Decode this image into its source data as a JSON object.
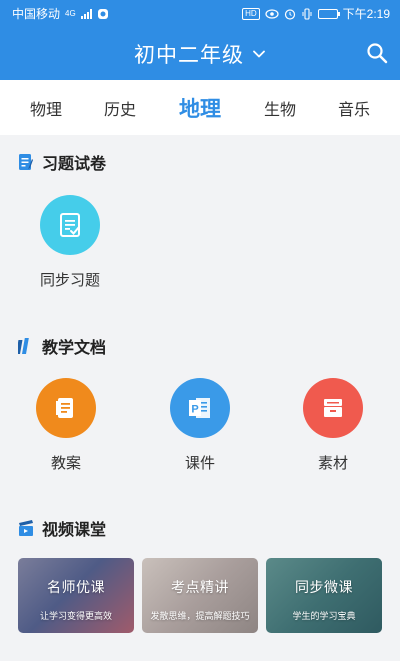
{
  "status_bar": {
    "carrier": "中国移动",
    "network": "4G",
    "hd": "HD",
    "time": "下午2:19"
  },
  "header": {
    "title": "初中二年级"
  },
  "tabs": [
    {
      "label": "物理"
    },
    {
      "label": "历史"
    },
    {
      "label": "地理"
    },
    {
      "label": "生物"
    },
    {
      "label": "音乐"
    }
  ],
  "active_tab": "地理",
  "sections": {
    "exercises": {
      "title": "习题试卷",
      "items": [
        {
          "label": "同步习题",
          "icon": "checklist-icon",
          "color": "#45cdea"
        }
      ]
    },
    "documents": {
      "title": "教学文档",
      "items": [
        {
          "label": "教案",
          "icon": "lesson-plan-icon",
          "color": "#f08a1c"
        },
        {
          "label": "课件",
          "icon": "powerpoint-icon",
          "color": "#3a9ae8"
        },
        {
          "label": "素材",
          "icon": "archive-box-icon",
          "color": "#f05a4e"
        }
      ]
    },
    "videos": {
      "title": "视频课堂",
      "cards": [
        {
          "title": "名师优课",
          "subtitle": "让学习变得更高效"
        },
        {
          "title": "考点精讲",
          "subtitle": "发散思维，提高解题技巧"
        },
        {
          "title": "同步微课",
          "subtitle": "学生的学习宝典"
        }
      ]
    }
  },
  "colors": {
    "primary": "#2f8de4",
    "background": "#f2f3f5"
  }
}
